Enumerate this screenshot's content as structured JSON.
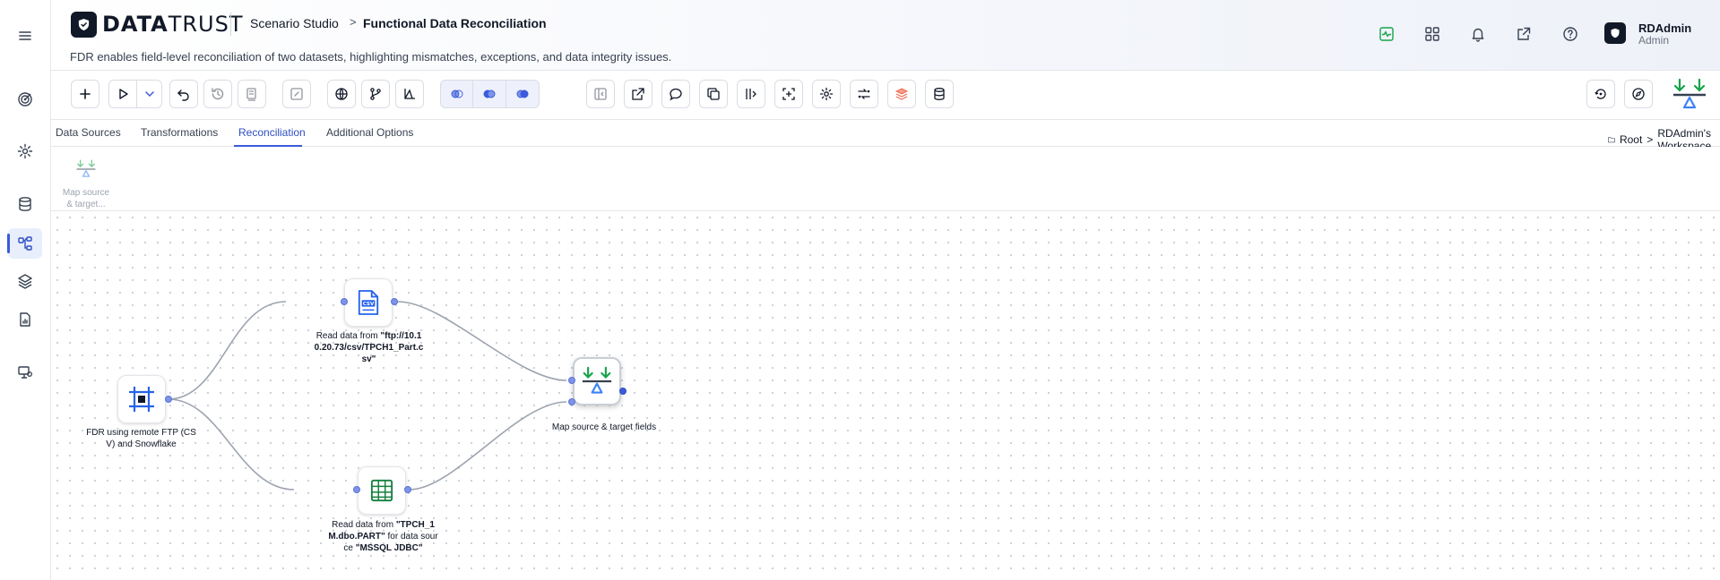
{
  "app": {
    "brand_bold": "DATA",
    "brand_light": "TRUST",
    "breadcrumb_root": "Scenario Studio",
    "breadcrumb_separator": ">",
    "breadcrumb_current": "Functional Data Reconciliation",
    "description": "FDR enables field-level reconciliation of two datasets, highlighting mismatches, exceptions, and data integrity issues."
  },
  "header_icons": [
    "activity-icon",
    "apps-grid-icon",
    "bell-icon",
    "external-link-icon",
    "help-icon"
  ],
  "user": {
    "name": "RDAdmin",
    "role": "Admin"
  },
  "rail_icons": [
    "menu-icon",
    "target-icon",
    "settings-icon",
    "database-icon",
    "workflow-icon",
    "layers-icon",
    "report-icon",
    "monitor-settings-icon"
  ],
  "tabs": [
    {
      "label": "Data Sources",
      "active": false
    },
    {
      "label": "Transformations",
      "active": false
    },
    {
      "label": "Reconciliation",
      "active": true
    },
    {
      "label": "Additional Options",
      "active": false
    }
  ],
  "workspace_path": {
    "root": "Root",
    "separator": ">",
    "workspace": "RDAdmin's Workspace"
  },
  "palette": {
    "items": [
      {
        "label": "Map source & target..."
      }
    ]
  },
  "nodes": {
    "source": {
      "label": "FDR using remote FTP (CSV) and Snowflake"
    },
    "csv": {
      "label_prefix": "Read data from ",
      "label_value": "\"ftp://10.10.20.73/csv/TPCH1_Part.csv\""
    },
    "table": {
      "label_prefix": "Read data from ",
      "label_value": "\"TPCH_1M.dbo.PART\"",
      "label_middle": " for data source ",
      "label_source": "\"MSSQL JDBC\""
    },
    "map": {
      "label": "Map source & target fields"
    }
  },
  "colors": {
    "accent": "#3b5bdb",
    "green": "#16a34a",
    "node_blue": "#2563eb",
    "table_green": "#15803d"
  }
}
